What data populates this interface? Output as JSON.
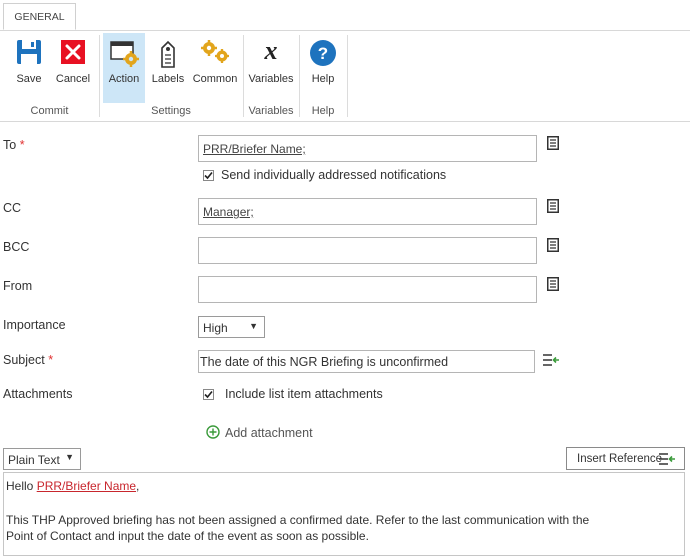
{
  "tabs": [
    "GENERAL"
  ],
  "ribbon": {
    "buttons": {
      "save": "Save",
      "cancel": "Cancel",
      "action": "Action",
      "labels": "Labels",
      "common": "Common",
      "variables": "Variables",
      "help": "Help"
    },
    "groups": {
      "commit": "Commit",
      "settings": "Settings",
      "variables": "Variables",
      "help": "Help"
    }
  },
  "form": {
    "to": {
      "label": "To",
      "required": "*",
      "value": "PRR/Briefer Name;"
    },
    "send_individually": {
      "label": "Send individually addressed notifications",
      "checked": true
    },
    "cc": {
      "label": "CC",
      "value": "Manager;"
    },
    "bcc": {
      "label": "BCC",
      "value": ""
    },
    "from": {
      "label": "From",
      "value": ""
    },
    "importance": {
      "label": "Importance",
      "value": "High"
    },
    "subject": {
      "label": "Subject",
      "required": "*",
      "value": "The date of this NGR Briefing is unconfirmed"
    },
    "attachments": {
      "label": "Attachments",
      "include_label": "Include list item attachments",
      "checked": true
    },
    "add_attachment": "Add attachment"
  },
  "editor": {
    "format": "Plain Text",
    "insert_reference": "Insert Reference",
    "greeting": "Hello ",
    "greeting_link": "PRR/Briefer Name",
    "greeting_end": ",",
    "body_line1": "This THP Approved briefing has not been assigned a confirmed date.  Refer to the last communication with the",
    "body_line2": "Point of Contact and input the date of the event as soon as possible."
  },
  "colors": {
    "accent": "#0072c6",
    "cancel_red": "#e81123",
    "required": "#e03030",
    "link": "#c8262d",
    "active_bg": "#cde6f7",
    "green": "#3a9a3a"
  }
}
